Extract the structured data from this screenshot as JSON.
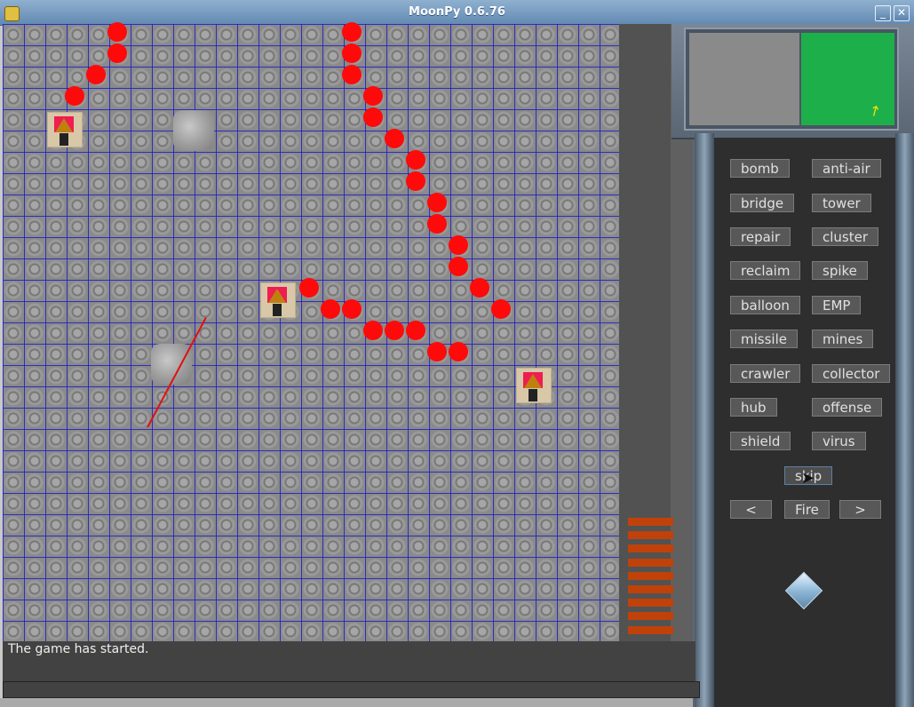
{
  "window": {
    "title": "MoonPy 0.6.76",
    "minimize_label": "_",
    "close_label": "✕"
  },
  "colors": {
    "path_marker": "#ff0a0a",
    "minimap_green": "#1db04a",
    "ammo_bar": "#c0420a"
  },
  "menu": {
    "weapons": [
      "bomb",
      "anti-air",
      "bridge",
      "tower",
      "repair",
      "cluster",
      "reclaim",
      "spike",
      "balloon",
      "EMP",
      "missile",
      "mines",
      "crawler",
      "collector",
      "hub",
      "offense",
      "shield",
      "virus"
    ],
    "skip_label": "skip",
    "prev_label": "<",
    "fire_label": "Fire",
    "next_label": ">"
  },
  "ammo_level": 9,
  "console": {
    "message": "The game has started."
  },
  "icons": {
    "app": "moonpy-app-icon",
    "gem": "crystal-icon",
    "cursor": "mouse-cursor-icon"
  }
}
